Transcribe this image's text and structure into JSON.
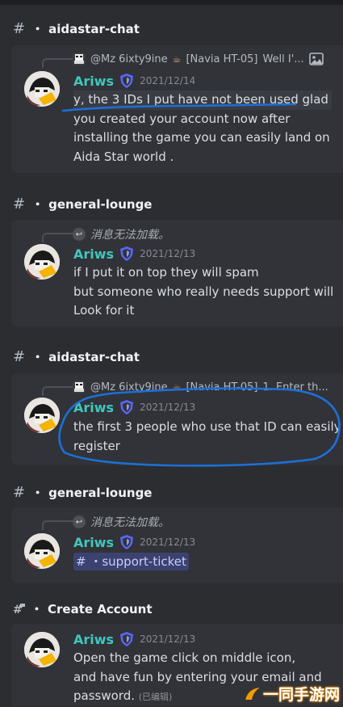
{
  "sections": [
    {
      "channel": {
        "name": "aidastar-chat",
        "icon": "hash-icon"
      },
      "reply": {
        "user": "@Mz 6ixty9ine",
        "tag": "[Navia HT-05]",
        "snippet": "Well I'...",
        "has_image_icon": true
      },
      "message": {
        "author": "Ariws",
        "timestamp": "2021/12/14",
        "lines": [
          "y, the 3 IDs I put have not been used glad",
          "you created your account now after",
          "installing the game you can easily land on",
          "Aida Star world ."
        ]
      }
    },
    {
      "channel": {
        "name": "general-lounge",
        "icon": "hash-icon"
      },
      "reply": {
        "unavailable": "消息无法加载。"
      },
      "message": {
        "author": "Ariws",
        "timestamp": "2021/12/13",
        "lines": [
          "if I put it on top they will spam",
          "but someone who really needs support will",
          "Look for it"
        ]
      }
    },
    {
      "channel": {
        "name": "aidastar-chat",
        "icon": "hash-icon"
      },
      "reply": {
        "user": "@Mz 6ixty9ine",
        "tag": "[Navia HT-05]",
        "snippet": "1. Enter th..."
      },
      "message": {
        "author": "Ariws",
        "timestamp": "2021/12/13",
        "lines": [
          "the first 3 people who use that ID can easily",
          "register"
        ]
      }
    },
    {
      "channel": {
        "name": "general-lounge",
        "icon": "hash-icon"
      },
      "reply": {
        "unavailable": "消息无法加载。"
      },
      "message": {
        "author": "Ariws",
        "timestamp": "2021/12/13",
        "mention": "# ・support-ticket"
      }
    },
    {
      "channel": {
        "name": "Create Account",
        "icon": "hash-speech-icon"
      },
      "message": {
        "author": "Ariws",
        "timestamp": "2021/12/13",
        "lines": [
          "Open the game click on middle icon,",
          "and have fun by entering your email and",
          "password."
        ],
        "edited": "(已编辑)"
      }
    }
  ],
  "separator_dot": "・",
  "watermark": "一同手游网",
  "colors": {
    "background": "#2b2d31",
    "card": "#313338",
    "author": "#3ec7bd",
    "ink": "#1d6fd6"
  }
}
